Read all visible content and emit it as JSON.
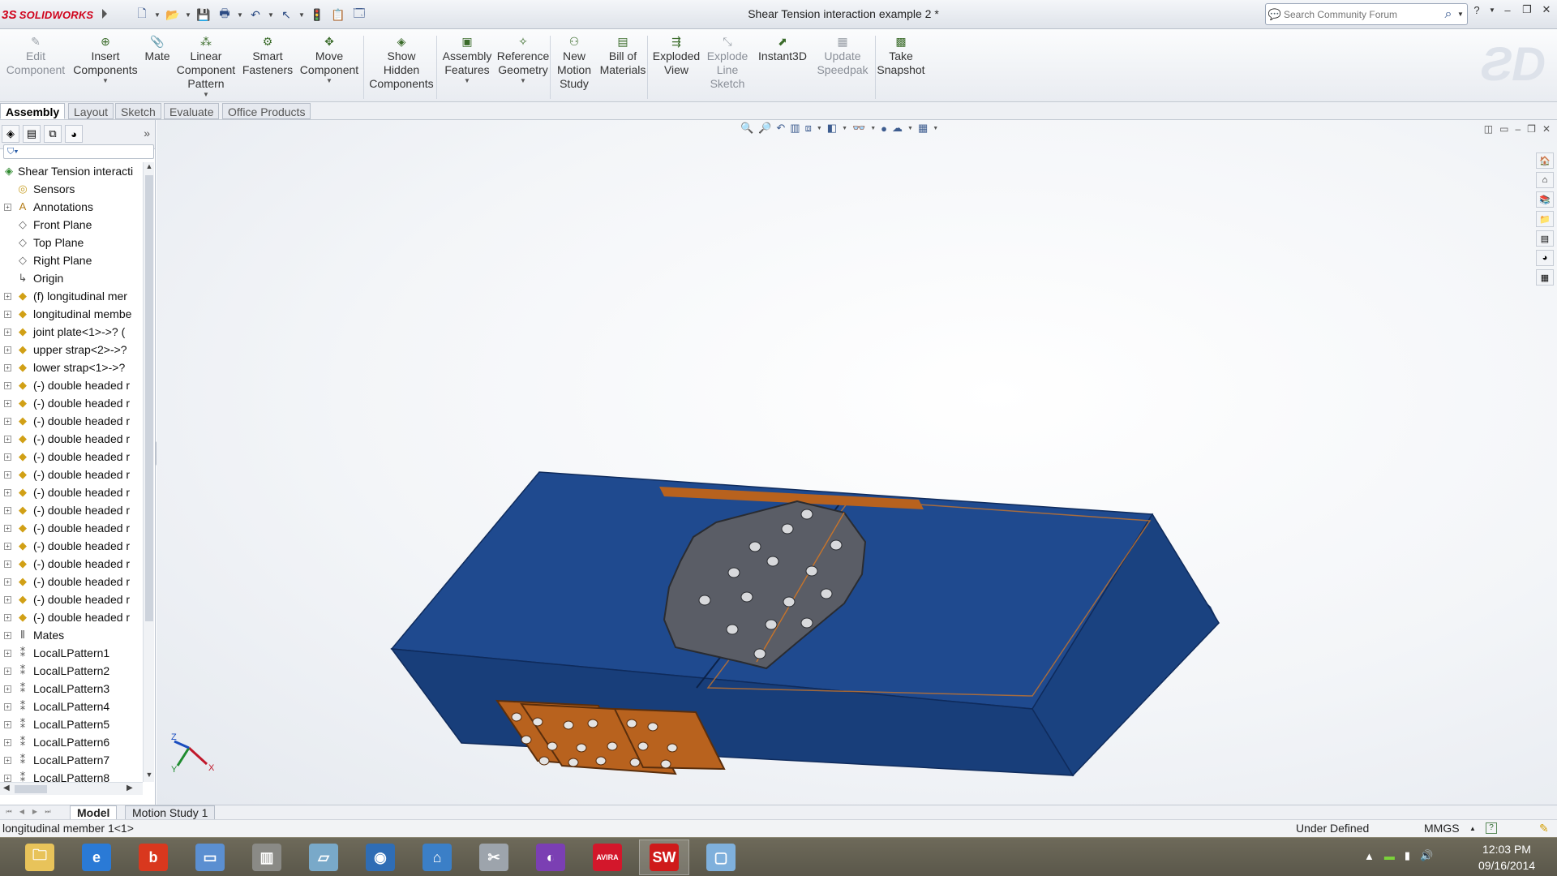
{
  "app": {
    "logo_text": "SOLIDWORKS",
    "doc_title": "Shear Tension interaction example 2 *",
    "search_placeholder": "Search Community Forum"
  },
  "quick_access": [
    {
      "name": "new-icon",
      "glyph": "🗋"
    },
    {
      "name": "open-icon",
      "glyph": "📂"
    },
    {
      "name": "save-icon",
      "glyph": "💾"
    },
    {
      "name": "print-icon",
      "glyph": "🖶"
    },
    {
      "name": "undo-icon",
      "glyph": "↶"
    },
    {
      "name": "select-icon",
      "glyph": "↖"
    },
    {
      "name": "rebuild-icon",
      "glyph": "🚦"
    },
    {
      "name": "file-properties-icon",
      "glyph": "📋"
    },
    {
      "name": "options-icon",
      "glyph": "🗔"
    }
  ],
  "commands": [
    {
      "label_lines": [
        "Edit",
        "Component"
      ],
      "icon": "edit-component-icon",
      "glyph": "✎",
      "enabled": false,
      "dropdown": false
    },
    {
      "label_lines": [
        "Insert",
        "Components"
      ],
      "icon": "insert-components-icon",
      "glyph": "⊕",
      "enabled": true,
      "dropdown": true
    },
    {
      "label_lines": [
        "Mate"
      ],
      "icon": "mate-icon",
      "glyph": "📎",
      "enabled": true,
      "dropdown": false
    },
    {
      "label_lines": [
        "Linear",
        "Component",
        "Pattern"
      ],
      "icon": "linear-pattern-icon",
      "glyph": "⁂",
      "enabled": true,
      "dropdown": true
    },
    {
      "label_lines": [
        "Smart",
        "Fasteners"
      ],
      "icon": "smart-fasteners-icon",
      "glyph": "⚙",
      "enabled": true,
      "dropdown": false
    },
    {
      "label_lines": [
        "Move",
        "Component"
      ],
      "icon": "move-component-icon",
      "glyph": "✥",
      "enabled": true,
      "dropdown": true
    },
    {
      "label_lines": [
        "Show",
        "Hidden",
        "Components"
      ],
      "icon": "show-hidden-icon",
      "glyph": "◈",
      "enabled": true,
      "dropdown": false
    },
    {
      "label_lines": [
        "Assembly",
        "Features"
      ],
      "icon": "assembly-features-icon",
      "glyph": "▣",
      "enabled": true,
      "dropdown": true
    },
    {
      "label_lines": [
        "Reference",
        "Geometry"
      ],
      "icon": "reference-geometry-icon",
      "glyph": "✧",
      "enabled": true,
      "dropdown": true
    },
    {
      "label_lines": [
        "New",
        "Motion",
        "Study"
      ],
      "icon": "motion-study-icon",
      "glyph": "⚇",
      "enabled": true,
      "dropdown": false
    },
    {
      "label_lines": [
        "Bill of",
        "Materials"
      ],
      "icon": "bill-of-materials-icon",
      "glyph": "▤",
      "enabled": true,
      "dropdown": false
    },
    {
      "label_lines": [
        "Exploded",
        "View"
      ],
      "icon": "exploded-view-icon",
      "glyph": "⇶",
      "enabled": true,
      "dropdown": false
    },
    {
      "label_lines": [
        "Explode",
        "Line",
        "Sketch"
      ],
      "icon": "explode-line-sketch-icon",
      "glyph": "⤡",
      "enabled": false,
      "dropdown": false
    },
    {
      "label_lines": [
        "Instant3D"
      ],
      "icon": "instant3d-icon",
      "glyph": "⬈",
      "enabled": true,
      "dropdown": false
    },
    {
      "label_lines": [
        "Update",
        "Speedpak"
      ],
      "icon": "update-speedpak-icon",
      "glyph": "▦",
      "enabled": false,
      "dropdown": false
    },
    {
      "label_lines": [
        "Take",
        "Snapshot"
      ],
      "icon": "take-snapshot-icon",
      "glyph": "▩",
      "enabled": true,
      "dropdown": false
    }
  ],
  "tabs": [
    "Assembly",
    "Layout",
    "Sketch",
    "Evaluate",
    "Office Products"
  ],
  "active_tab": "Assembly",
  "tree": [
    {
      "label": "Shear Tension interacti",
      "icon": "assembly-icon",
      "glyph": "◈",
      "color": "#2f8a2f",
      "expander": false,
      "root": true
    },
    {
      "label": "Sensors",
      "icon": "sensors-icon",
      "glyph": "◎",
      "color": "#c9a12a",
      "expander": false
    },
    {
      "label": "Annotations",
      "icon": "annotations-icon",
      "glyph": "A",
      "color": "#b47d1a",
      "expander": true
    },
    {
      "label": "Front Plane",
      "icon": "plane-icon",
      "glyph": "◇",
      "color": "#666666",
      "expander": false
    },
    {
      "label": "Top Plane",
      "icon": "plane-icon",
      "glyph": "◇",
      "color": "#666666",
      "expander": false
    },
    {
      "label": "Right Plane",
      "icon": "plane-icon",
      "glyph": "◇",
      "color": "#666666",
      "expander": false
    },
    {
      "label": "Origin",
      "icon": "origin-icon",
      "glyph": "↳",
      "color": "#555555",
      "expander": false
    },
    {
      "label": "(f) longitudinal mer",
      "icon": "part-icon",
      "glyph": "◆",
      "color": "#d1a016",
      "expander": true
    },
    {
      "label": "longitudinal membe",
      "icon": "part-icon",
      "glyph": "◆",
      "color": "#d1a016",
      "expander": true
    },
    {
      "label": "joint plate<1>->? (",
      "icon": "part-icon",
      "glyph": "◆",
      "color": "#d1a016",
      "expander": true
    },
    {
      "label": "upper strap<2>->?",
      "icon": "part-icon",
      "glyph": "◆",
      "color": "#d1a016",
      "expander": true
    },
    {
      "label": "lower strap<1>->?",
      "icon": "part-icon",
      "glyph": "◆",
      "color": "#d1a016",
      "expander": true
    },
    {
      "label": "(-) double headed r",
      "icon": "part-icon",
      "glyph": "◆",
      "color": "#d1a016",
      "expander": true
    },
    {
      "label": "(-) double headed r",
      "icon": "part-icon",
      "glyph": "◆",
      "color": "#d1a016",
      "expander": true
    },
    {
      "label": "(-) double headed r",
      "icon": "part-icon",
      "glyph": "◆",
      "color": "#d1a016",
      "expander": true
    },
    {
      "label": "(-) double headed r",
      "icon": "part-icon",
      "glyph": "◆",
      "color": "#d1a016",
      "expander": true
    },
    {
      "label": "(-) double headed r",
      "icon": "part-icon",
      "glyph": "◆",
      "color": "#d1a016",
      "expander": true
    },
    {
      "label": "(-) double headed r",
      "icon": "part-icon",
      "glyph": "◆",
      "color": "#d1a016",
      "expander": true
    },
    {
      "label": "(-) double headed r",
      "icon": "part-icon",
      "glyph": "◆",
      "color": "#d1a016",
      "expander": true
    },
    {
      "label": "(-) double headed r",
      "icon": "part-icon",
      "glyph": "◆",
      "color": "#d1a016",
      "expander": true
    },
    {
      "label": "(-) double headed r",
      "icon": "part-icon",
      "glyph": "◆",
      "color": "#d1a016",
      "expander": true
    },
    {
      "label": "(-) double headed r",
      "icon": "part-icon",
      "glyph": "◆",
      "color": "#d1a016",
      "expander": true
    },
    {
      "label": "(-) double headed r",
      "icon": "part-icon",
      "glyph": "◆",
      "color": "#d1a016",
      "expander": true
    },
    {
      "label": "(-) double headed r",
      "icon": "part-icon",
      "glyph": "◆",
      "color": "#d1a016",
      "expander": true
    },
    {
      "label": "(-) double headed r",
      "icon": "part-icon",
      "glyph": "◆",
      "color": "#d1a016",
      "expander": true
    },
    {
      "label": "(-) double headed r",
      "icon": "part-icon",
      "glyph": "◆",
      "color": "#d1a016",
      "expander": true
    },
    {
      "label": "Mates",
      "icon": "mates-icon",
      "glyph": "⫴",
      "color": "#555555",
      "expander": true
    },
    {
      "label": "LocalLPattern1",
      "icon": "pattern-icon",
      "glyph": "⁑",
      "color": "#555555",
      "expander": true
    },
    {
      "label": "LocalLPattern2",
      "icon": "pattern-icon",
      "glyph": "⁑",
      "color": "#555555",
      "expander": true
    },
    {
      "label": "LocalLPattern3",
      "icon": "pattern-icon",
      "glyph": "⁑",
      "color": "#555555",
      "expander": true
    },
    {
      "label": "LocalLPattern4",
      "icon": "pattern-icon",
      "glyph": "⁑",
      "color": "#555555",
      "expander": true
    },
    {
      "label": "LocalLPattern5",
      "icon": "pattern-icon",
      "glyph": "⁑",
      "color": "#555555",
      "expander": true
    },
    {
      "label": "LocalLPattern6",
      "icon": "pattern-icon",
      "glyph": "⁑",
      "color": "#555555",
      "expander": true
    },
    {
      "label": "LocalLPattern7",
      "icon": "pattern-icon",
      "glyph": "⁑",
      "color": "#555555",
      "expander": true
    },
    {
      "label": "LocalLPattern8",
      "icon": "pattern-icon",
      "glyph": "⁑",
      "color": "#555555",
      "expander": true
    }
  ],
  "bottom_tabs": [
    "Model",
    "Motion Study 1"
  ],
  "status": {
    "selection": "longitudinal member 1<1>",
    "definition": "Under Defined",
    "units": "MMGS",
    "help": "?"
  },
  "taskbar": {
    "apps": [
      {
        "name": "file-explorer-icon",
        "glyph": "🗀",
        "bg": "#e8c35a"
      },
      {
        "name": "internet-explorer-icon",
        "glyph": "e",
        "bg": "#2a7ad6"
      },
      {
        "name": "bitdefender-icon",
        "glyph": "b",
        "bg": "#d9381e"
      },
      {
        "name": "remote-desktop-icon",
        "glyph": "▭",
        "bg": "#5b8fd1"
      },
      {
        "name": "city-app-icon",
        "glyph": "▥",
        "bg": "#8a8a86"
      },
      {
        "name": "folder-app-icon",
        "glyph": "▱",
        "bg": "#79a9c9"
      },
      {
        "name": "media-app-icon",
        "glyph": "◉",
        "bg": "#2f6db5"
      },
      {
        "name": "network-app-icon",
        "glyph": "⌂",
        "bg": "#3b7fc7"
      },
      {
        "name": "tools-app-icon",
        "glyph": "✂",
        "bg": "#9da4ac"
      },
      {
        "name": "browser-app-icon",
        "glyph": "◐",
        "bg": "#7b3fb3"
      },
      {
        "name": "avira-icon",
        "glyph": "AVIRA",
        "bg": "#d3172b"
      },
      {
        "name": "solidworks-app-icon",
        "glyph": "SW",
        "bg": "#cf1a1a"
      },
      {
        "name": "folder-blue-icon",
        "glyph": "▢",
        "bg": "#7fb0dc"
      }
    ],
    "time": "12:03 PM",
    "date": "09/16/2014"
  },
  "colors": {
    "channel": "#1f4a8f",
    "channel_dark": "#173a72",
    "plate": "#5a5d66",
    "strap": "#b8621e",
    "accent": "#d0021b"
  },
  "triad": {
    "x_label": "X",
    "y_label": "Y",
    "z_label": "Z"
  }
}
